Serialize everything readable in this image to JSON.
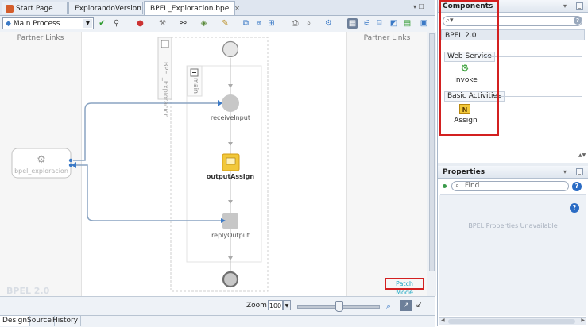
{
  "tabs": [
    {
      "label": "Start Page",
      "active": false
    },
    {
      "label": "ExplorandoVersion",
      "active": false
    },
    {
      "label": "BPEL_Exploracion.bpel",
      "active": true
    }
  ],
  "toolbar": {
    "process_select": "Main Process"
  },
  "canvas": {
    "left_lane": "Partner Links",
    "right_lane": "Partner Links",
    "scope_label": "BPEL_Exploracion",
    "sequence_label": "main",
    "partner_link": "bpel_exploracion",
    "activities": [
      "receiveInput",
      "outputAssign",
      "replyOutput"
    ],
    "watermark": "BPEL 2.0",
    "patch_mode": "Patch Mode"
  },
  "zoom": {
    "label": "Zoom:",
    "value": "100"
  },
  "bottom_tabs": [
    "Design",
    "Source",
    "History"
  ],
  "components": {
    "title": "Components",
    "category": "BPEL 2.0",
    "sections": [
      {
        "label": "Web Service",
        "items": [
          {
            "label": "Invoke",
            "icon": "invoke-icon"
          }
        ]
      },
      {
        "label": "Basic Activities",
        "items": [
          {
            "label": "Assign",
            "icon": "assign-icon"
          }
        ]
      }
    ]
  },
  "properties": {
    "title": "Properties",
    "search_placeholder": "Find",
    "empty_text": "BPEL Properties Unavailable"
  },
  "colors": {
    "highlight_red": "#d32020",
    "link_blue": "#3a79c6",
    "assign_yellow": "#f2c83a",
    "patch_mode": "#18a6c4"
  }
}
